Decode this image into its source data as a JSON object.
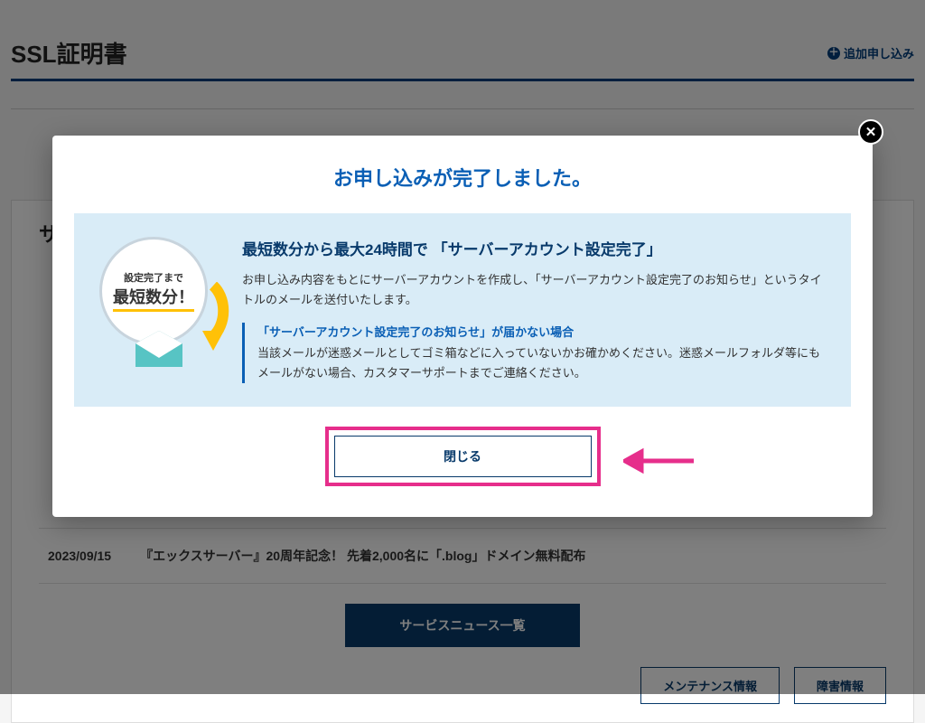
{
  "section": {
    "title": "SSL証明書",
    "add_label": "追加申し込み"
  },
  "service_section": {
    "title_char": "サ"
  },
  "news": {
    "date": "2023/09/15",
    "title": "『エックスサーバー』20周年記念！ 先着2,000名に「.blog」ドメイン無料配布"
  },
  "buttons": {
    "service_news_list": "サービスニュース一覧",
    "maintenance_info": "メンテナンス情報",
    "fault_info": "障害情報"
  },
  "modal": {
    "title": "お申し込みが完了しました。",
    "badge_line1": "設定完了まで",
    "badge_line2": "最短数分！",
    "heading": "最短数分から最大24時間で 「サーバーアカウント設定完了」",
    "paragraph": "お申し込み内容をもとにサーバーアカウントを作成し、「サーバーアカウント設定完了のお知らせ」というタイトルのメールを送付いたします。",
    "note_title": "「サーバーアカウント設定完了のお知らせ」が届かない場合",
    "note_body": "当該メールが迷惑メールとしてゴミ箱などに入っていないかお確かめください。迷惑メールフォルダ等にもメールがない場合、カスタマーサポートまでご連絡ください。",
    "close_label": "閉じる"
  }
}
